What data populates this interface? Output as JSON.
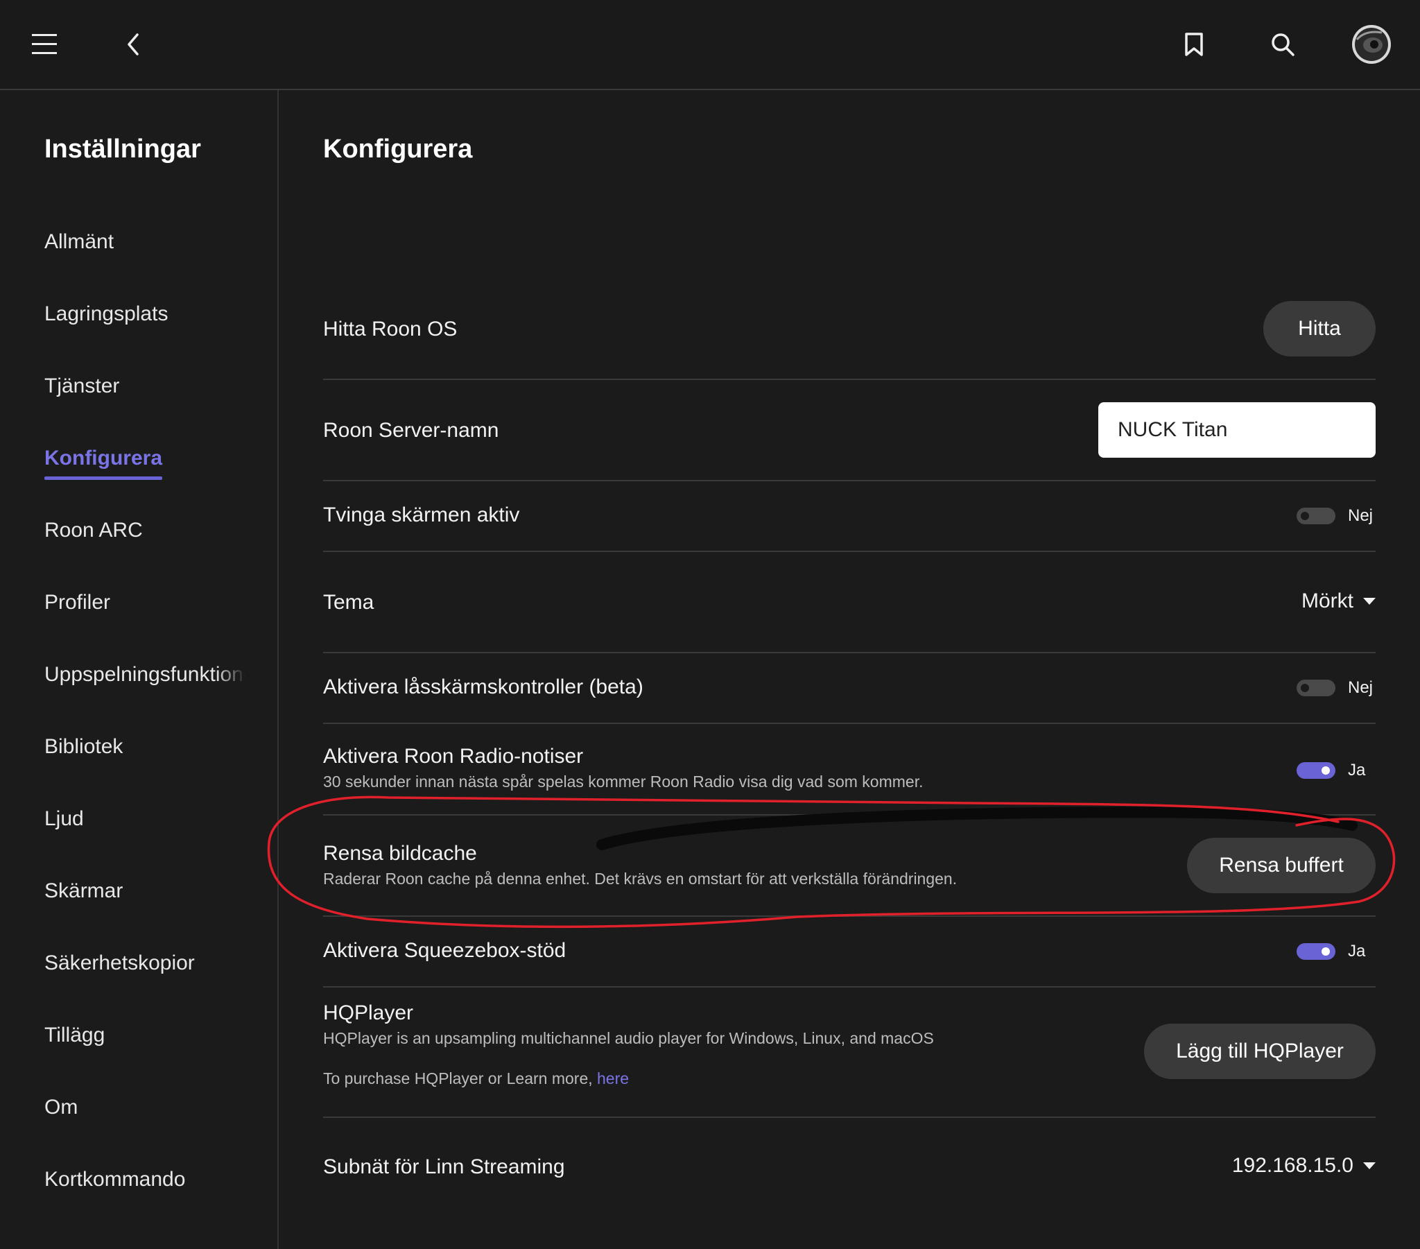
{
  "topbar": {
    "menu_icon": "hamburger-menu-icon",
    "back_icon": "chevron-left-icon",
    "bookmark_icon": "bookmark-icon",
    "search_icon": "search-icon",
    "avatar_icon": "user-avatar"
  },
  "sidebar": {
    "title": "Inställningar",
    "items": [
      {
        "label": "Allmänt"
      },
      {
        "label": "Lagringsplats"
      },
      {
        "label": "Tjänster"
      },
      {
        "label": "Konfigurera",
        "active": true
      },
      {
        "label": "Roon ARC"
      },
      {
        "label": "Profiler"
      },
      {
        "label": "Uppspelningsfunktioner"
      },
      {
        "label": "Bibliotek"
      },
      {
        "label": "Ljud"
      },
      {
        "label": "Skärmar"
      },
      {
        "label": "Säkerhetskopior"
      },
      {
        "label": "Tillägg"
      },
      {
        "label": "Om"
      },
      {
        "label": "Kortkommando"
      }
    ]
  },
  "main": {
    "title": "Konfigurera",
    "find_os": {
      "label": "Hitta Roon OS",
      "button": "Hitta"
    },
    "server_name": {
      "label": "Roon Server-namn",
      "value": "NUCK Titan"
    },
    "keep_screen": {
      "label": "Tvinga skärmen aktiv",
      "state": "Nej",
      "on": false
    },
    "theme": {
      "label": "Tema",
      "value": "Mörkt"
    },
    "lockscreen": {
      "label": "Aktivera låsskärmskontroller (beta)",
      "state": "Nej",
      "on": false
    },
    "radio": {
      "label": "Aktivera Roon Radio-notiser",
      "description": "30 sekunder innan nästa spår spelas kommer Roon Radio visa dig vad som kommer.",
      "state": "Ja",
      "on": true
    },
    "cache": {
      "label": "Rensa bildcache",
      "description": "Raderar Roon cache på denna enhet. Det krävs en omstart för att verkställa förändringen.",
      "button": "Rensa buffert"
    },
    "squeezebox": {
      "label": "Aktivera Squeezebox-stöd",
      "state": "Ja",
      "on": true
    },
    "hqplayer": {
      "label": "HQPlayer",
      "description": "HQPlayer is an upsampling multichannel audio player for Windows, Linux, and macOS",
      "purchase_text": "To purchase HQPlayer or Learn more, ",
      "purchase_link": "here",
      "button": "Lägg till HQPlayer"
    },
    "linn": {
      "label": "Subnät för Linn Streaming",
      "value": "192.168.15.0"
    }
  },
  "colors": {
    "accent": "#6a63d6",
    "background": "#1b1b1b",
    "annotation_red": "#e0202a"
  }
}
